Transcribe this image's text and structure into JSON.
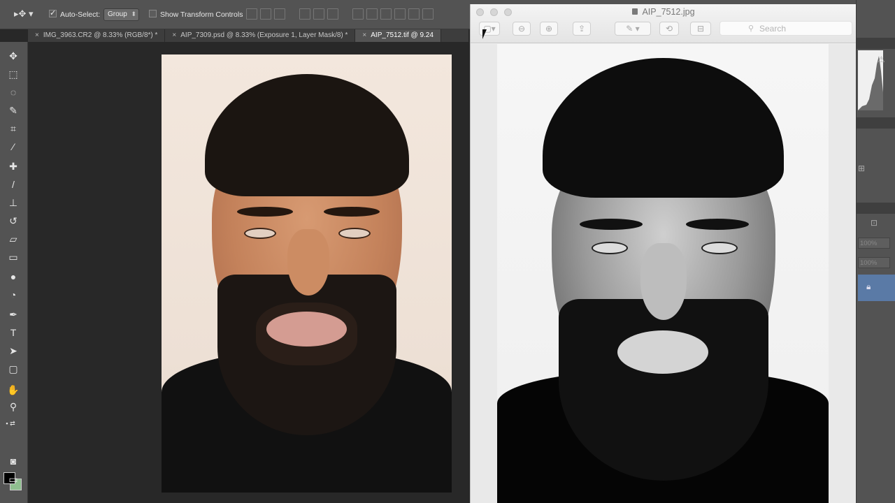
{
  "options_bar": {
    "auto_select_label": "Auto-Select:",
    "auto_select_checked": true,
    "group_select_value": "Group",
    "show_transform_label": "Show Transform Controls",
    "show_transform_checked": false
  },
  "doc_tabs": [
    {
      "label": "IMG_3963.CR2 @ 8.33% (RGB/8*) *",
      "active": false
    },
    {
      "label": "AIP_7309.psd @ 8.33% (Exposure 1, Layer Mask/8) *",
      "active": false
    },
    {
      "label": "AIP_7512.tif @ 9.24",
      "active": true
    }
  ],
  "tools": [
    "move-icon",
    "marquee-icon",
    "lasso-icon",
    "quick-select-icon",
    "crop-icon",
    "eyedropper-icon",
    "healing-brush-icon",
    "brush-icon",
    "clone-stamp-icon",
    "history-brush-icon",
    "eraser-icon",
    "gradient-icon",
    "blur-icon",
    "dodge-icon",
    "pen-icon",
    "type-icon",
    "path-select-icon",
    "rectangle-icon",
    "hand-icon",
    "zoom-icon"
  ],
  "colors": {
    "foreground": "#000000",
    "background": "#8fbf8f"
  },
  "preview": {
    "title": "AIP_7512.jpg",
    "search_placeholder": "Search"
  },
  "right_panel": {
    "opacity_value": "100%",
    "fill_value": "100%"
  }
}
